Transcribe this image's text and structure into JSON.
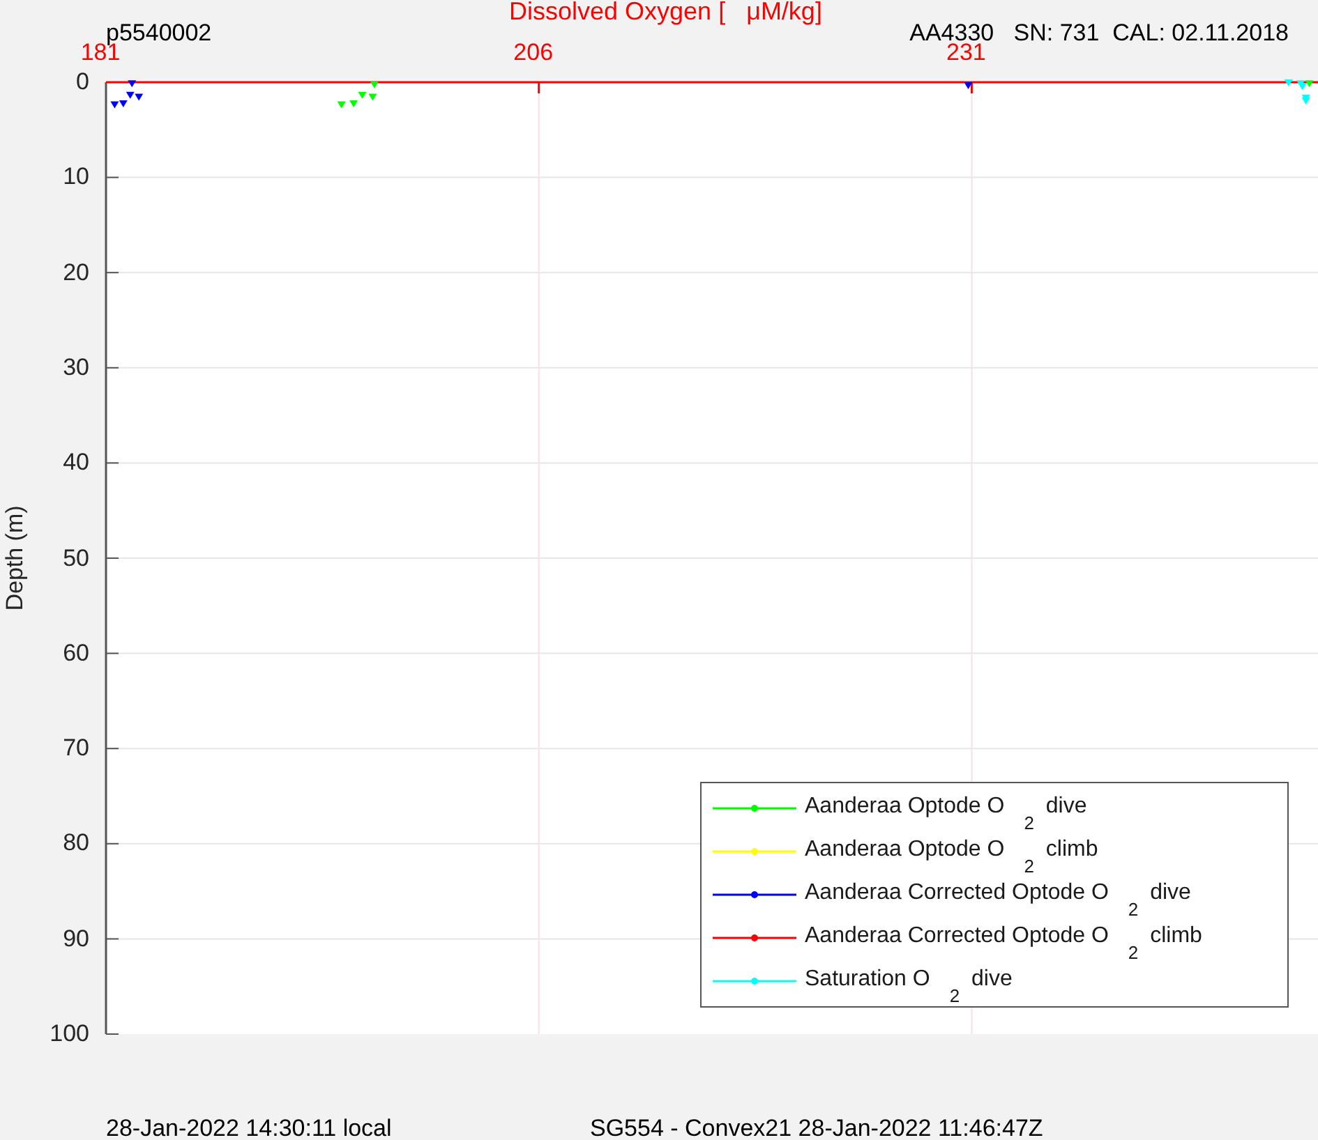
{
  "header": {
    "deployment": "p5540002",
    "instrument": "AA4330   SN: 731  CAL: 02.11.2018"
  },
  "chart_data": {
    "type": "scatter",
    "xlabel": "Dissolved Oxygen [   μM/kg]",
    "ylabel": "Depth (m)",
    "xlim": [
      181,
      251
    ],
    "ylim": [
      100,
      0
    ],
    "grid": true,
    "legend": true,
    "xticks": [
      181,
      206,
      231
    ],
    "yticks": [
      0,
      10,
      20,
      30,
      40,
      50,
      60,
      70,
      80,
      90,
      100
    ],
    "series": [
      {
        "name": "Aanderaa Optode O$_{2}$ dive",
        "color": "#00ff00",
        "x": [
          194.6,
          195.3,
          195.8,
          196.4,
          196.5,
          250.5
        ],
        "values": [
          2.3,
          2.2,
          1.3,
          1.5,
          0.2,
          0.1
        ]
      },
      {
        "name": "Aanderaa Optode O$_{2}$ climb",
        "color": "#ffff00"
      },
      {
        "name": "Aanderaa Corrected Optode O$_{2}$ dive",
        "color": "#0000ff",
        "x": [
          181.5,
          182.0,
          182.4,
          182.9,
          182.5,
          230.8
        ],
        "values": [
          2.3,
          2.2,
          1.3,
          1.5,
          0.1,
          0.3
        ]
      },
      {
        "name": "Aanderaa Corrected Optode O$_{2}$ climb",
        "color": "#ff0000"
      },
      {
        "name": "Saturation O$_{2}$ dive",
        "color": "#00ffff",
        "x": [
          249.3,
          250.0,
          250.1,
          250.3,
          250.3
        ],
        "values": [
          0.0,
          0.1,
          0.4,
          1.6,
          1.9
        ]
      }
    ]
  },
  "footer": {
    "local_time": "28-Jan-2022 14:30:11 local",
    "mission": "SG554 - Convex21 28-Jan-2022 11:46:47Z"
  }
}
